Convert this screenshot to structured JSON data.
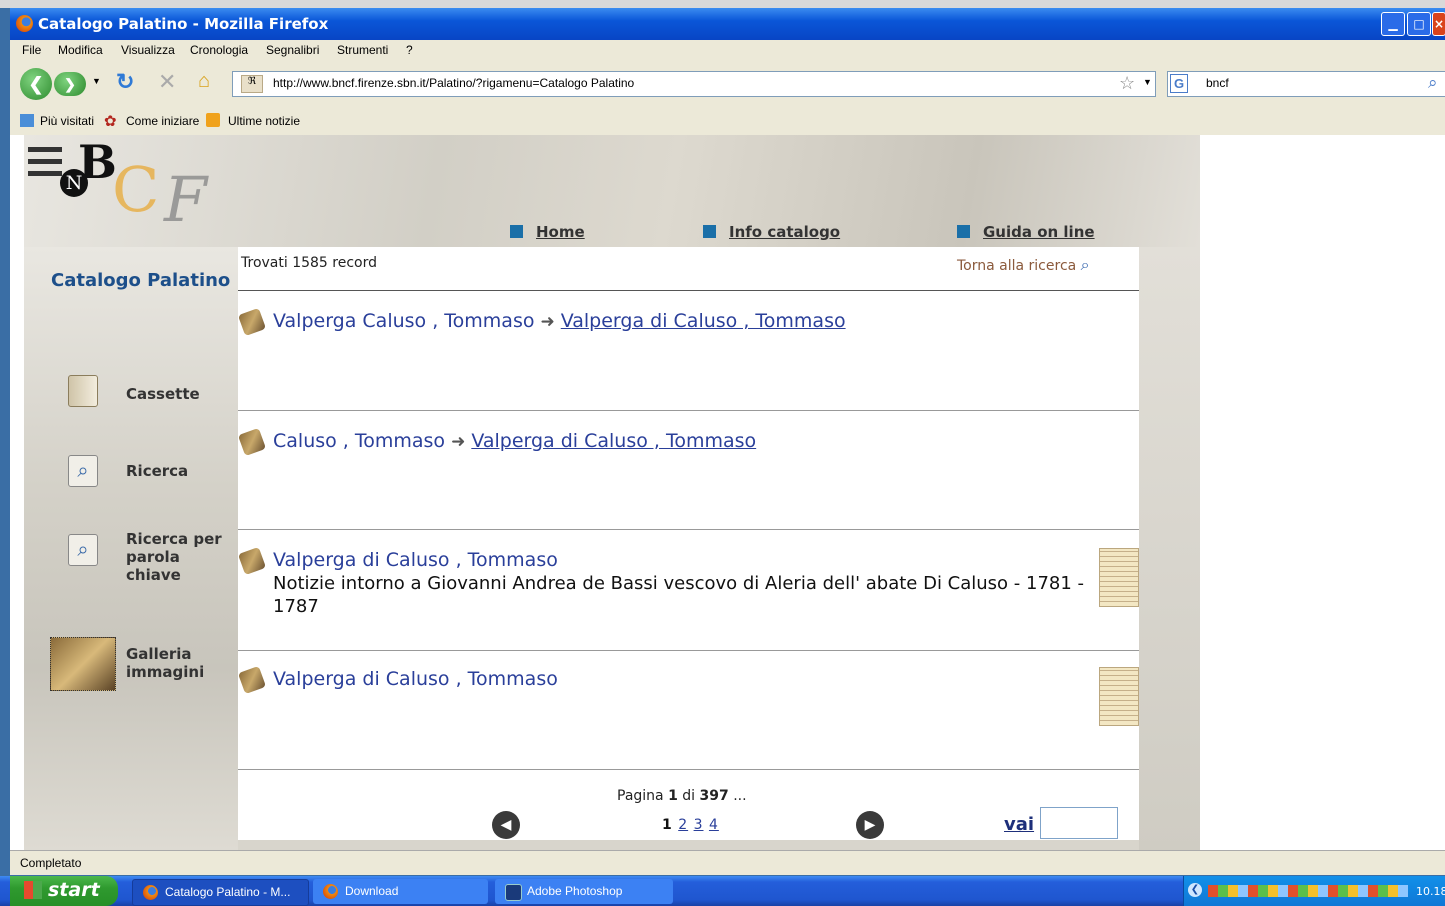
{
  "window": {
    "title": "Catalogo Palatino - Mozilla Firefox"
  },
  "menu": [
    "File",
    "Modifica",
    "Visualizza",
    "Cronologia",
    "Segnalibri",
    "Strumenti",
    "?"
  ],
  "address": {
    "url": "http://www.bncf.firenze.sbn.it/Palatino/?rigamenu=Catalogo Palatino"
  },
  "search": {
    "value": "bncf"
  },
  "bookmarks": [
    "Più visitati",
    "Come iniziare",
    "Ultime notizie"
  ],
  "site": {
    "logo_letters": "BNCF",
    "nav": [
      "Home",
      "Info catalogo",
      "Guida on line"
    ],
    "section_title": "Catalogo Palatino",
    "sidebar": [
      {
        "label": "Cassette",
        "icon": "drawer-icon"
      },
      {
        "label": "Ricerca",
        "icon": "magnifier-icon"
      },
      {
        "label_line1": "Ricerca per",
        "label_line2": "parola chiave",
        "icon": "magnifier-icon"
      },
      {
        "label_line1": "Galleria",
        "label_line2": "immagini",
        "icon": "gallery-icon"
      }
    ]
  },
  "results": {
    "found": "Trovati 1585 record",
    "back_link": "Torna alla ricerca",
    "records": [
      {
        "title": "Valperga Caluso , Tommaso",
        "see": "Valperga di Caluso , Tommaso"
      },
      {
        "title": "Caluso , Tommaso",
        "see": "Valperga di Caluso , Tommaso"
      },
      {
        "title": "Valperga di Caluso , Tommaso",
        "description": "Notizie intorno a Giovanni Andrea de Bassi vescovo di Aleria dell' abate Di Caluso - 1781 - 1787",
        "has_thumbnail": true
      },
      {
        "title": "Valperga di Caluso , Tommaso",
        "has_thumbnail": true
      }
    ],
    "pagination": {
      "label": "Pagina",
      "current": "1",
      "of": "di",
      "total": "397",
      "ellipsis": "...",
      "pages": [
        "1",
        "2",
        "3",
        "4"
      ],
      "go_label": "vai",
      "go_value": ""
    }
  },
  "status": {
    "text": "Completato"
  },
  "taskbar": {
    "start": "start",
    "tasks": [
      "Catalogo Palatino - M...",
      "Download",
      "Adobe Photoshop"
    ],
    "clock": "10.18"
  }
}
